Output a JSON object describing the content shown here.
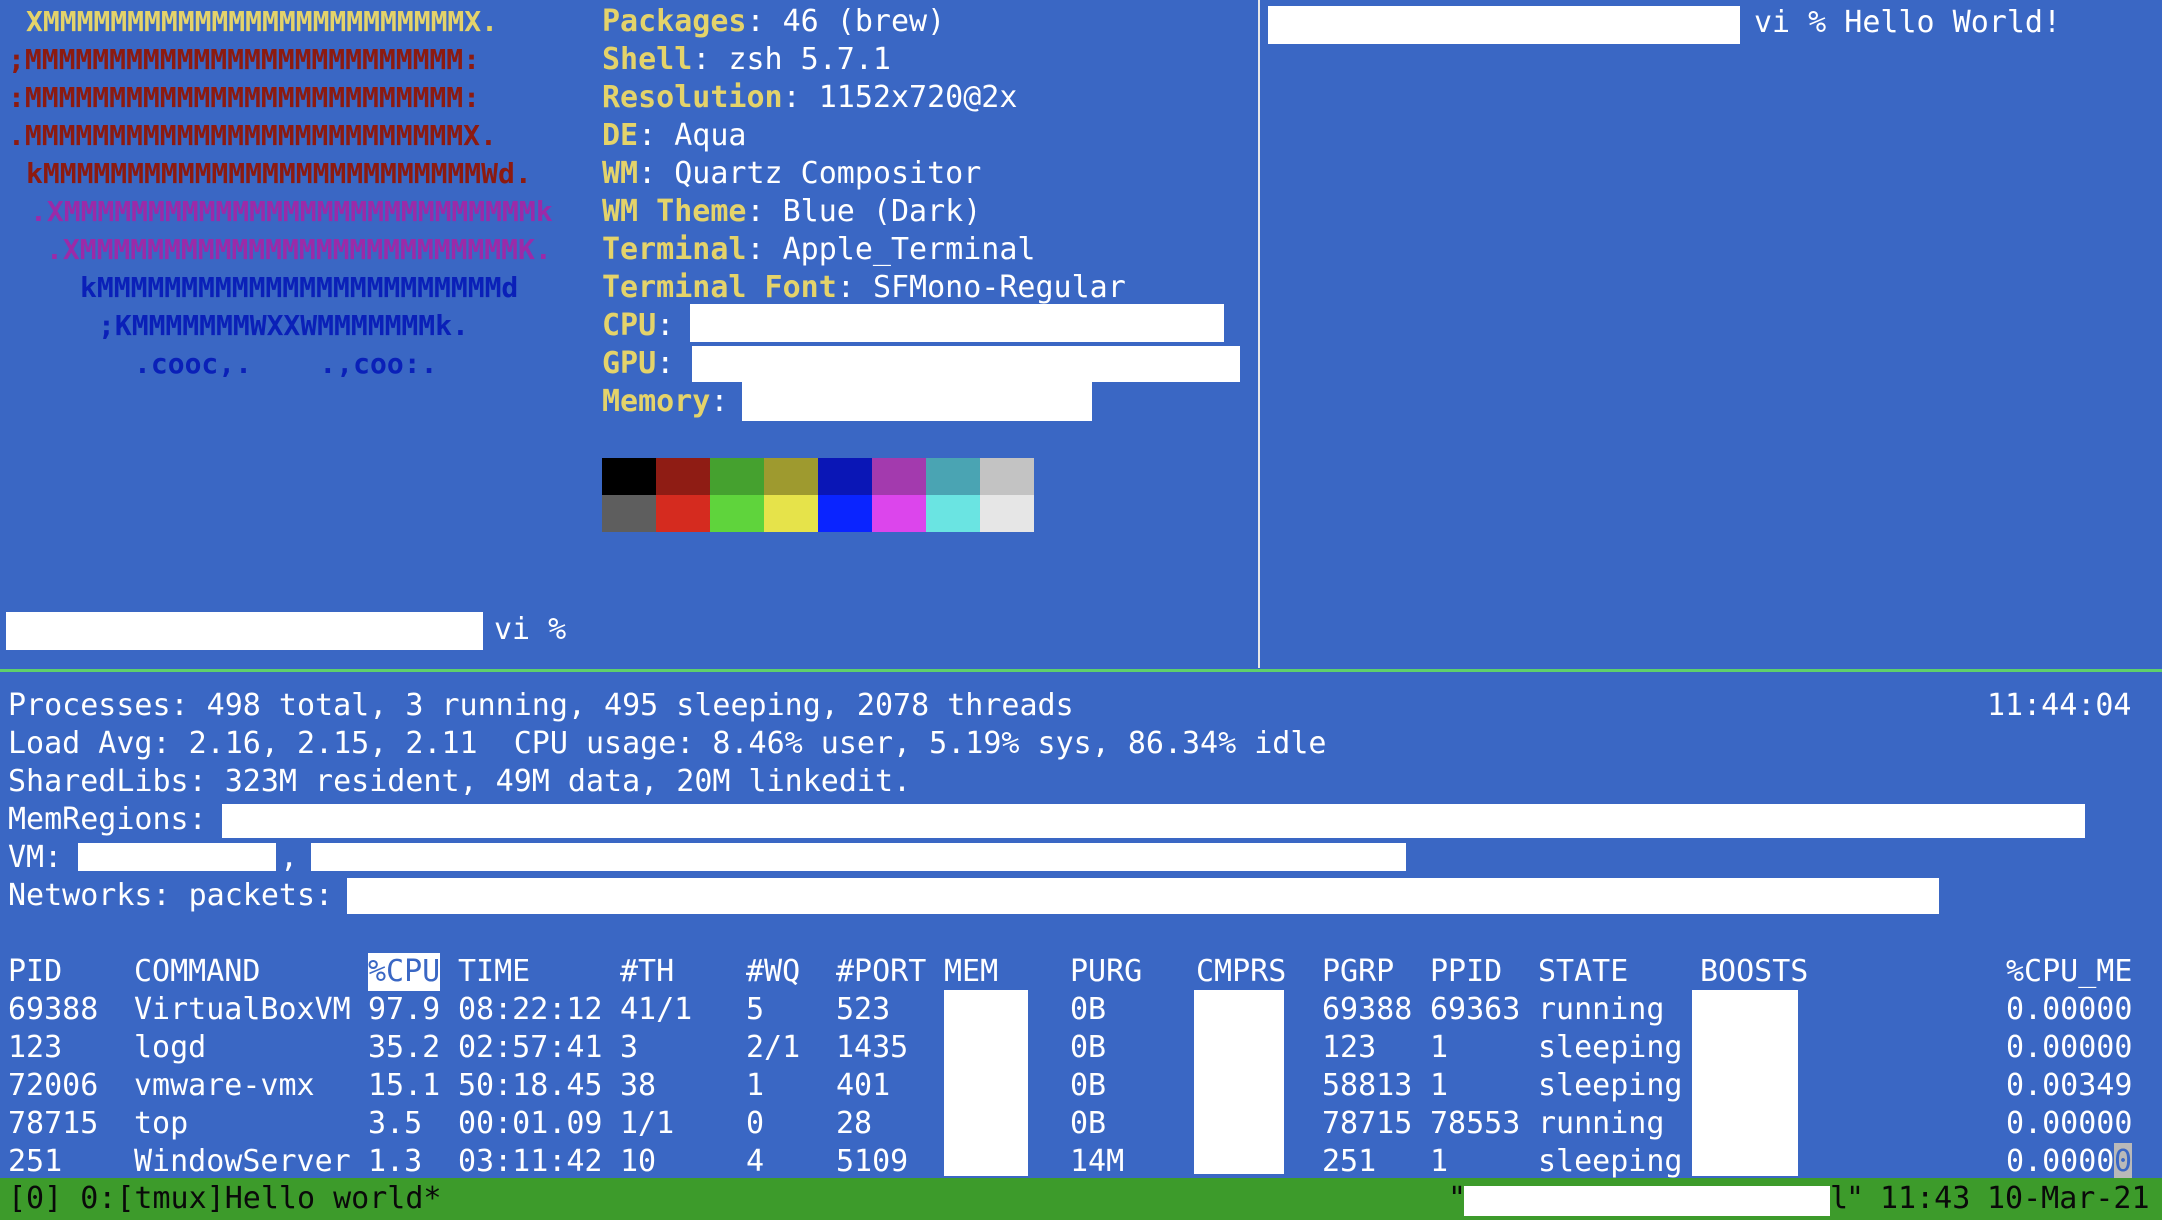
{
  "colors": {
    "background": "#3a67c4",
    "key": "#e4d36a",
    "status_bar": "#3d9b2b",
    "separator": "#5fd06a"
  },
  "logo": [
    {
      "text": "XMMMMMMMMMMMMMMMMMMMMMMMMMX.",
      "color": "#e4d36a"
    },
    {
      "text": ";MMMMMMMMMMMMMMMMMMMMMMMMMM:",
      "color": "#8c1a10"
    },
    {
      "text": ":MMMMMMMMMMMMMMMMMMMMMMMMMM:",
      "color": "#8c1a10"
    },
    {
      "text": ".MMMMMMMMMMMMMMMMMMMMMMMMMMX.",
      "color": "#8c1a10"
    },
    {
      "text": "kMMMMMMMMMMMMMMMMMMMMMMMMMMWd.",
      "color": "#8c1a10"
    },
    {
      "text": ".XMMMMMMMMMMMMMMMMMMMMMMMMMMMMk",
      "color": "#9c2aa8"
    },
    {
      "text": ".XMMMMMMMMMMMMMMMMMMMMMMMMMMK.",
      "color": "#9c2aa8"
    },
    {
      "text": "kMMMMMMMMMMMMMMMMMMMMMMMMd",
      "color": "#0a20b8"
    },
    {
      "text": ";KMMMMMMMWXXWMMMMMMMk.",
      "color": "#0a20b8"
    },
    {
      "text": ".cooc,.    .,coo:.",
      "color": "#0a20b8"
    }
  ],
  "sysinfo": [
    {
      "key": "Packages",
      "value": "46 (brew)"
    },
    {
      "key": "Shell",
      "value": "zsh 5.7.1"
    },
    {
      "key": "Resolution",
      "value": "1152x720@2x"
    },
    {
      "key": "DE",
      "value": "Aqua"
    },
    {
      "key": "WM",
      "value": "Quartz Compositor"
    },
    {
      "key": "WM Theme",
      "value": "Blue (Dark)"
    },
    {
      "key": "Terminal",
      "value": "Apple_Terminal"
    },
    {
      "key": "Terminal Font",
      "value": "SFMono-Regular"
    },
    {
      "key": "CPU",
      "value": ""
    },
    {
      "key": "GPU",
      "value": ""
    },
    {
      "key": "Memory",
      "value": ""
    }
  ],
  "palette_row1": [
    "#000000",
    "#8f1c14",
    "#45a12f",
    "#9e9a2f",
    "#0a16b6",
    "#a33aae",
    "#4aa4b3",
    "#c3c3c3"
  ],
  "palette_row2": [
    "#5e5e5e",
    "#d52b1f",
    "#5fd43c",
    "#e6e34a",
    "#0a24ff",
    "#dc45ec",
    "#6ae4e2",
    "#e6e6e6"
  ],
  "left_prompt": "vi %",
  "right_prompt": "vi % Hello World!",
  "top": {
    "processes": "Processes: 498 total, 3 running, 495 sleeping, 2078 threads",
    "clock": "11:44:04",
    "load": "Load Avg: 2.16, 2.15, 2.11  CPU usage: 8.46% user, 5.19% sys, 86.34% idle",
    "sharedlibs": "SharedLibs: 323M resident, 49M data, 20M linkedit.",
    "memregions": "MemRegions:",
    "vm": "VM:",
    "vm_sep": ",",
    "networks": "Networks: packets:"
  },
  "table": {
    "headers": [
      "PID",
      "COMMAND",
      "%CPU",
      "TIME",
      "#TH",
      "#WQ",
      "#PORT",
      "MEM",
      "PURG",
      "CMPRS",
      "PGRP",
      "PPID",
      "STATE",
      "BOOSTS",
      "%CPU_ME"
    ],
    "rows": [
      [
        "69388",
        "VirtualBoxVM",
        "97.9",
        "08:22:12",
        "41/1",
        "5",
        "523",
        "",
        "0B",
        "",
        "69388",
        "69363",
        "running",
        "",
        "0.00000"
      ],
      [
        "123",
        "logd",
        "35.2",
        "02:57:41",
        "3",
        "2/1",
        "1435",
        "",
        "0B",
        "",
        "123",
        "1",
        "sleeping",
        "",
        "0.00000"
      ],
      [
        "72006",
        "vmware-vmx",
        "15.1",
        "50:18.45",
        "38",
        "1",
        "401",
        "",
        "0B",
        "",
        "58813",
        "1",
        "sleeping",
        "",
        "0.00349"
      ],
      [
        "78715",
        "top",
        "3.5",
        "00:01.09",
        "1/1",
        "0",
        "28",
        "",
        "0B",
        "",
        "78715",
        "78553",
        "running",
        "",
        "0.00000"
      ],
      [
        "251",
        "WindowServer",
        "1.3",
        "03:11:42",
        "10",
        "4",
        "5109",
        "",
        "14M",
        "",
        "251",
        "1",
        "sleeping",
        "",
        "0.0000"
      ]
    ],
    "last_cursor_char": "0"
  },
  "status": {
    "left": "[0] 0:[tmux]Hello world*",
    "quote_open": "\"",
    "fragment": "l",
    "quote_close": "\"",
    "time": "11:43",
    "date": "10-Mar-21"
  }
}
